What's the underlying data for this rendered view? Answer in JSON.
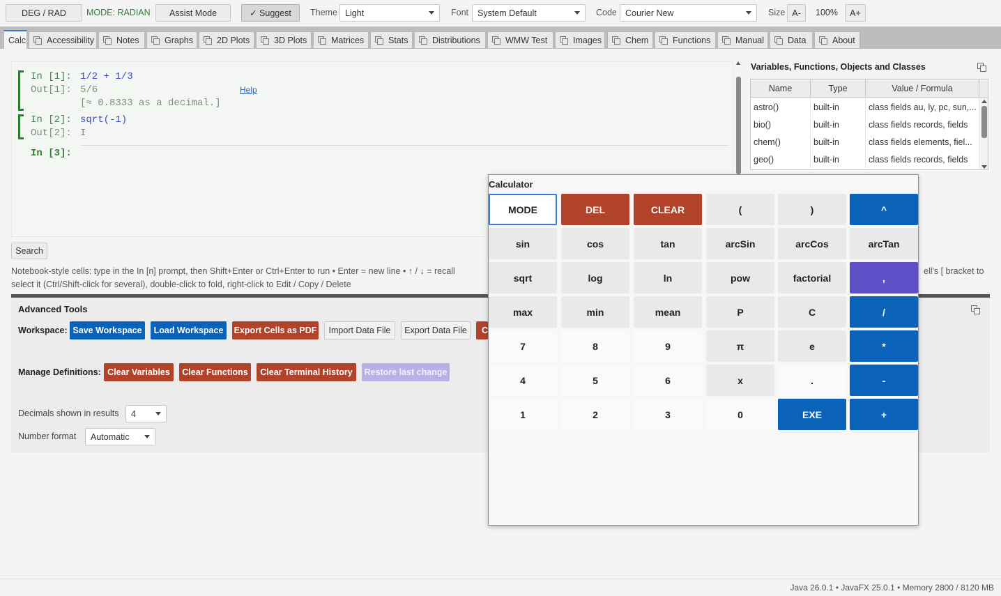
{
  "toolbar": {
    "deg_rad": "DEG / RAD",
    "mode": "MODE: RADIAN",
    "assist": "Assist Mode",
    "suggest": "✓ Suggest",
    "theme_label": "Theme",
    "theme_value": "Light",
    "font_label": "Font",
    "font_value": "System Default",
    "code_label": "Code",
    "code_value": "Courier New",
    "size_label": "Size",
    "size_minus": "A-",
    "size_value": "100%",
    "size_plus": "A+"
  },
  "tabs": [
    "Calc",
    "Accessibility",
    "Notes",
    "Graphs",
    "2D Plots",
    "3D Plots",
    "Matrices",
    "Stats",
    "Distributions",
    "WMW Test",
    "Images",
    "Chem",
    "Functions",
    "Manual",
    "Data",
    "About"
  ],
  "notebook": {
    "cell1_in_prompt": "In [1]:",
    "cell1_in": "1/2 + 1/3",
    "cell1_out_prompt": "Out[1]:",
    "cell1_out": "5/6",
    "cell1_help": "Help",
    "cell1_approx": "[≈ 0.8333 as a decimal.]",
    "cell2_in_prompt": "In [2]:",
    "cell2_in": "sqrt(-1)",
    "cell2_out_prompt": "Out[2]:",
    "cell2_out": "I",
    "cell3_prompt": "In [3]:"
  },
  "variables": {
    "title": "Variables, Functions, Objects and Classes",
    "headers": [
      "Name",
      "Type",
      "Value / Formula"
    ],
    "rows": [
      {
        "name": "astro()",
        "type": "built-in",
        "value": "class fields au, ly, pc, sun,..."
      },
      {
        "name": "bio()",
        "type": "built-in",
        "value": "class fields records, fields"
      },
      {
        "name": "chem()",
        "type": "built-in",
        "value": "class fields elements, fiel..."
      },
      {
        "name": "geo()",
        "type": "built-in",
        "value": "class fields records, fields"
      }
    ]
  },
  "search_label": "Search",
  "help_line1_left": "Notebook-style cells: type in the In [n] prompt, then Shift+Enter or Ctrl+Enter to run  •  Enter = new line  •  ↑ / ↓ = recall",
  "help_line1_right": "ell's [ bracket to",
  "help_line2": "select it (Ctrl/Shift-click for several), double-click to fold, right-click to Edit / Copy / Delete",
  "advanced": {
    "title": "Advanced Tools",
    "workspace_label": "Workspace:",
    "save": "Save Workspace",
    "load": "Load Workspace",
    "export_pdf": "Export Cells as PDF",
    "import_data": "Import Data File",
    "export_data": "Export Data File",
    "clipped_btn": "C",
    "manage_label": "Manage Definitions:",
    "clear_vars": "Clear Variables",
    "clear_funcs": "Clear Functions",
    "clear_history": "Clear Terminal History",
    "restore": "Restore last change",
    "decimals_label": "Decimals shown in results",
    "decimals_value": "4",
    "format_label": "Number format",
    "format_value": "Automatic"
  },
  "calculator": {
    "title": "Calculator",
    "keys": [
      [
        "MODE",
        "DEL",
        "CLEAR",
        "(",
        ")",
        "^"
      ],
      [
        "sin",
        "cos",
        "tan",
        "arcSin",
        "arcCos",
        "arcTan"
      ],
      [
        "sqrt",
        "log",
        "ln",
        "pow",
        "factorial",
        ","
      ],
      [
        "max",
        "min",
        "mean",
        "P",
        "C",
        "/"
      ],
      [
        "7",
        "8",
        "9",
        "π",
        "e",
        "*"
      ],
      [
        "4",
        "5",
        "6",
        "x",
        ".",
        "-"
      ],
      [
        "1",
        "2",
        "3",
        "0",
        "EXE",
        "+"
      ]
    ],
    "key_styles": [
      [
        "mode",
        "red",
        "red",
        "fn",
        "fn",
        "blue"
      ],
      [
        "fn",
        "fn",
        "fn",
        "fn",
        "fn",
        "fn"
      ],
      [
        "fn",
        "fn",
        "fn",
        "fn",
        "fn",
        "purple"
      ],
      [
        "fn",
        "fn",
        "fn",
        "fn",
        "fn",
        "blue"
      ],
      [
        "num",
        "num",
        "num",
        "fn",
        "fn",
        "blue"
      ],
      [
        "num",
        "num",
        "num",
        "fn",
        "num",
        "blue"
      ],
      [
        "num",
        "num",
        "num",
        "num",
        "blue",
        "blue"
      ]
    ]
  },
  "status": "Java 26.0.1  •  JavaFX 25.0.1  •  Memory 2800 / 8120 MB"
}
